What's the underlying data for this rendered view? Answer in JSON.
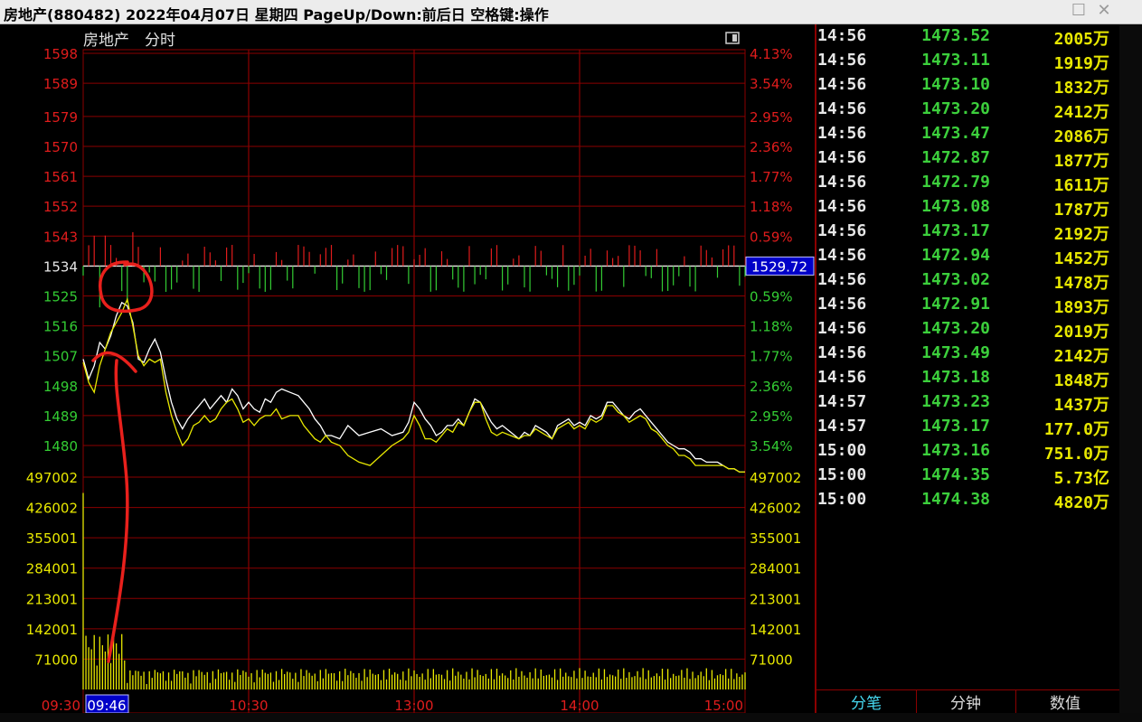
{
  "window": {
    "title": "房地产(880482)  2022年04月07日 星期四 PageUp/Down:前后日 空格键:操作",
    "maximize_icon": "maximize-icon",
    "close_icon": "close-icon"
  },
  "chart_header": {
    "name": "房地产",
    "mode": "分时",
    "toggle_icon": "panel-toggle-icon"
  },
  "colors": {
    "red": "#e01c1c",
    "green": "#33cc33",
    "yellow": "#e8e800",
    "white": "#ffffff",
    "grid": "#8b0000"
  },
  "chart_data": {
    "type": "line",
    "price_axis": {
      "labels": [
        "1598",
        "1589",
        "1579",
        "1570",
        "1561",
        "1552",
        "1543",
        "1534",
        "1525",
        "1516",
        "1507",
        "1498",
        "1489",
        "1480"
      ],
      "values": [
        1598,
        1589,
        1579,
        1570,
        1561,
        1552,
        1543,
        1534,
        1525,
        1516,
        1507,
        1498,
        1489,
        1480
      ],
      "pct_labels": [
        "4.13%",
        "3.54%",
        "2.95%",
        "2.36%",
        "1.77%",
        "1.18%",
        "0.59%",
        "",
        "0.59%",
        "1.18%",
        "1.77%",
        "2.36%",
        "2.95%",
        "3.54%"
      ],
      "pct_sign": [
        "up",
        "up",
        "up",
        "up",
        "up",
        "up",
        "up",
        "",
        "down",
        "down",
        "down",
        "down",
        "down",
        "down"
      ],
      "prev_close": 1534,
      "current_label": "1529.72",
      "ylim": [
        1480,
        1598
      ]
    },
    "volume_axis": {
      "labels": [
        "497002",
        "426002",
        "355001",
        "284001",
        "213001",
        "142001",
        "71000"
      ],
      "values": [
        497002,
        426002,
        355001,
        284001,
        213001,
        142001,
        71000
      ],
      "ylim": [
        0,
        497002
      ]
    },
    "time_axis": {
      "labels": [
        "09:30",
        "10:30",
        "13:00",
        "14:00",
        "15:00"
      ],
      "minutes": [
        0,
        60,
        120,
        180,
        240
      ],
      "cursor_label": "09:46",
      "cursor_minute": 16,
      "total_minutes": 240
    },
    "series": [
      {
        "color": "white",
        "x": [
          0,
          2,
          4,
          6,
          8,
          10,
          12,
          14,
          16,
          18,
          20,
          22,
          24,
          26,
          28,
          30,
          32,
          34,
          36,
          38,
          40,
          42,
          44,
          46,
          48,
          50,
          52,
          54,
          56,
          58,
          60,
          62,
          64,
          66,
          68,
          70,
          72,
          75,
          78,
          80,
          82,
          84,
          86,
          88,
          90,
          93,
          96,
          100,
          104,
          108,
          112,
          116,
          118,
          120,
          122,
          124,
          126,
          128,
          130,
          132,
          134,
          136,
          138,
          140,
          142,
          144,
          146,
          148,
          150,
          152,
          155,
          158,
          160,
          162,
          164,
          166,
          168,
          170,
          172,
          174,
          176,
          178,
          180,
          182,
          184,
          186,
          188,
          190,
          192,
          194,
          196,
          198,
          200,
          202,
          204,
          206,
          208,
          210,
          212,
          214,
          216,
          218,
          220,
          222,
          224,
          226,
          228,
          230,
          232,
          234,
          236,
          238,
          240
        ],
        "y": [
          1506,
          1500,
          1504,
          1511,
          1509,
          1513,
          1519,
          1523,
          1522,
          1517,
          1506,
          1505,
          1509,
          1512,
          1508,
          1500,
          1493,
          1488,
          1485,
          1488,
          1490,
          1492,
          1494,
          1491,
          1493,
          1495,
          1493,
          1497,
          1495,
          1491,
          1493,
          1491,
          1490,
          1494,
          1493,
          1496,
          1497,
          1496,
          1495,
          1493,
          1491,
          1488,
          1486,
          1483,
          1483,
          1482,
          1486,
          1483,
          1484,
          1485,
          1483,
          1484,
          1487,
          1493,
          1491,
          1488,
          1486,
          1483,
          1484,
          1486,
          1486,
          1488,
          1486,
          1490,
          1494,
          1493,
          1490,
          1487,
          1485,
          1486,
          1484,
          1482,
          1484,
          1483,
          1486,
          1485,
          1484,
          1482,
          1486,
          1487,
          1488,
          1486,
          1487,
          1486,
          1489,
          1488,
          1489,
          1493,
          1493,
          1491,
          1489,
          1488,
          1490,
          1491,
          1489,
          1487,
          1485,
          1483,
          1481,
          1480,
          1479,
          1479,
          1478,
          1476,
          1476,
          1475,
          1475,
          1475,
          1474,
          1473,
          1473,
          1472,
          1472
        ]
      },
      {
        "color": "yellow",
        "x": [
          0,
          2,
          4,
          6,
          8,
          10,
          12,
          14,
          16,
          18,
          20,
          22,
          24,
          26,
          28,
          30,
          32,
          34,
          36,
          38,
          40,
          42,
          44,
          46,
          48,
          50,
          52,
          54,
          56,
          58,
          60,
          62,
          64,
          66,
          68,
          70,
          72,
          75,
          78,
          80,
          82,
          84,
          86,
          88,
          90,
          93,
          96,
          100,
          104,
          108,
          112,
          116,
          118,
          120,
          122,
          124,
          126,
          128,
          130,
          132,
          134,
          136,
          138,
          140,
          142,
          144,
          146,
          148,
          150,
          152,
          155,
          158,
          160,
          162,
          164,
          166,
          168,
          170,
          172,
          174,
          176,
          178,
          180,
          182,
          184,
          186,
          188,
          190,
          192,
          194,
          196,
          198,
          200,
          202,
          204,
          206,
          208,
          210,
          212,
          214,
          216,
          218,
          220,
          222,
          224,
          226,
          228,
          230,
          232,
          234,
          236,
          238,
          240
        ],
        "y": [
          1505,
          1499,
          1496,
          1504,
          1509,
          1514,
          1517,
          1520,
          1524,
          1516,
          1507,
          1504,
          1506,
          1505,
          1506,
          1496,
          1489,
          1484,
          1480,
          1482,
          1486,
          1487,
          1489,
          1487,
          1488,
          1491,
          1493,
          1494,
          1491,
          1487,
          1488,
          1486,
          1488,
          1489,
          1489,
          1491,
          1488,
          1489,
          1489,
          1486,
          1484,
          1482,
          1481,
          1483,
          1481,
          1480,
          1477,
          1475,
          1474,
          1477,
          1480,
          1482,
          1484,
          1489,
          1486,
          1482,
          1482,
          1481,
          1483,
          1485,
          1484,
          1487,
          1486,
          1490,
          1493,
          1493,
          1488,
          1484,
          1483,
          1484,
          1483,
          1482,
          1483,
          1483,
          1485,
          1484,
          1483,
          1482,
          1485,
          1486,
          1487,
          1485,
          1486,
          1485,
          1488,
          1487,
          1488,
          1492,
          1492,
          1490,
          1489,
          1487,
          1488,
          1489,
          1488,
          1485,
          1484,
          1482,
          1480,
          1479,
          1477,
          1477,
          1476,
          1474,
          1474,
          1474,
          1474,
          1474,
          1474,
          1473,
          1473,
          1472,
          1472
        ]
      }
    ]
  },
  "ticks": [
    {
      "time": "14:56",
      "price": "1473.52",
      "volume": "2005万"
    },
    {
      "time": "14:56",
      "price": "1473.11",
      "volume": "1919万"
    },
    {
      "time": "14:56",
      "price": "1473.10",
      "volume": "1832万"
    },
    {
      "time": "14:56",
      "price": "1473.20",
      "volume": "2412万"
    },
    {
      "time": "14:56",
      "price": "1473.47",
      "volume": "2086万"
    },
    {
      "time": "14:56",
      "price": "1472.87",
      "volume": "1877万"
    },
    {
      "time": "14:56",
      "price": "1472.79",
      "volume": "1611万"
    },
    {
      "time": "14:56",
      "price": "1473.08",
      "volume": "1787万"
    },
    {
      "time": "14:56",
      "price": "1473.17",
      "volume": "2192万"
    },
    {
      "time": "14:56",
      "price": "1472.94",
      "volume": "1452万"
    },
    {
      "time": "14:56",
      "price": "1473.02",
      "volume": "1478万"
    },
    {
      "time": "14:56",
      "price": "1472.91",
      "volume": "1893万"
    },
    {
      "time": "14:56",
      "price": "1473.20",
      "volume": "2019万"
    },
    {
      "time": "14:56",
      "price": "1473.49",
      "volume": "2142万"
    },
    {
      "time": "14:56",
      "price": "1473.18",
      "volume": "1848万"
    },
    {
      "time": "14:57",
      "price": "1473.23",
      "volume": "1437万"
    },
    {
      "time": "14:57",
      "price": "1473.17",
      "volume": "177.0万"
    },
    {
      "time": "15:00",
      "price": "1473.16",
      "volume": "751.0万"
    },
    {
      "time": "15:00",
      "price": "1474.35",
      "volume": "5.73亿"
    },
    {
      "time": "15:00",
      "price": "1474.38",
      "volume": "4820万"
    }
  ],
  "tabs": [
    "分笔",
    "分钟",
    "数值"
  ],
  "active_tab": 0
}
